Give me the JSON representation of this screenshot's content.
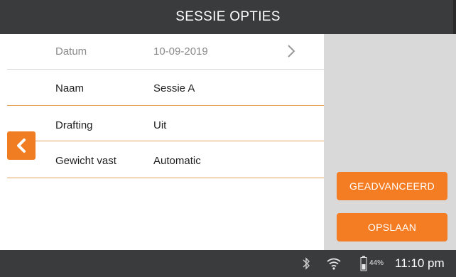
{
  "header": {
    "title": "SESSIE OPTIES"
  },
  "settings": {
    "rows": [
      {
        "label": "Datum",
        "value": "10-09-2019"
      },
      {
        "label": "Naam",
        "value": "Sessie A"
      },
      {
        "label": "Drafting",
        "value": "Uit"
      },
      {
        "label": "Gewicht vast",
        "value": "Automatic"
      }
    ]
  },
  "actions": {
    "advanced_label": "GEADVANCEERD",
    "save_label": "OPSLAAN"
  },
  "status": {
    "battery_percent": "44%",
    "time": "11:10 pm"
  },
  "icons": {
    "back": "chevron-left-icon",
    "row_chevron": "chevron-right-icon",
    "bluetooth": "bluetooth-icon",
    "wifi": "wifi-icon",
    "battery": "battery-icon"
  },
  "colors": {
    "accent": "#f47c22",
    "bar": "#3a3b3d",
    "side_panel": "#d9d9d9",
    "separator": "#e4a25a"
  }
}
